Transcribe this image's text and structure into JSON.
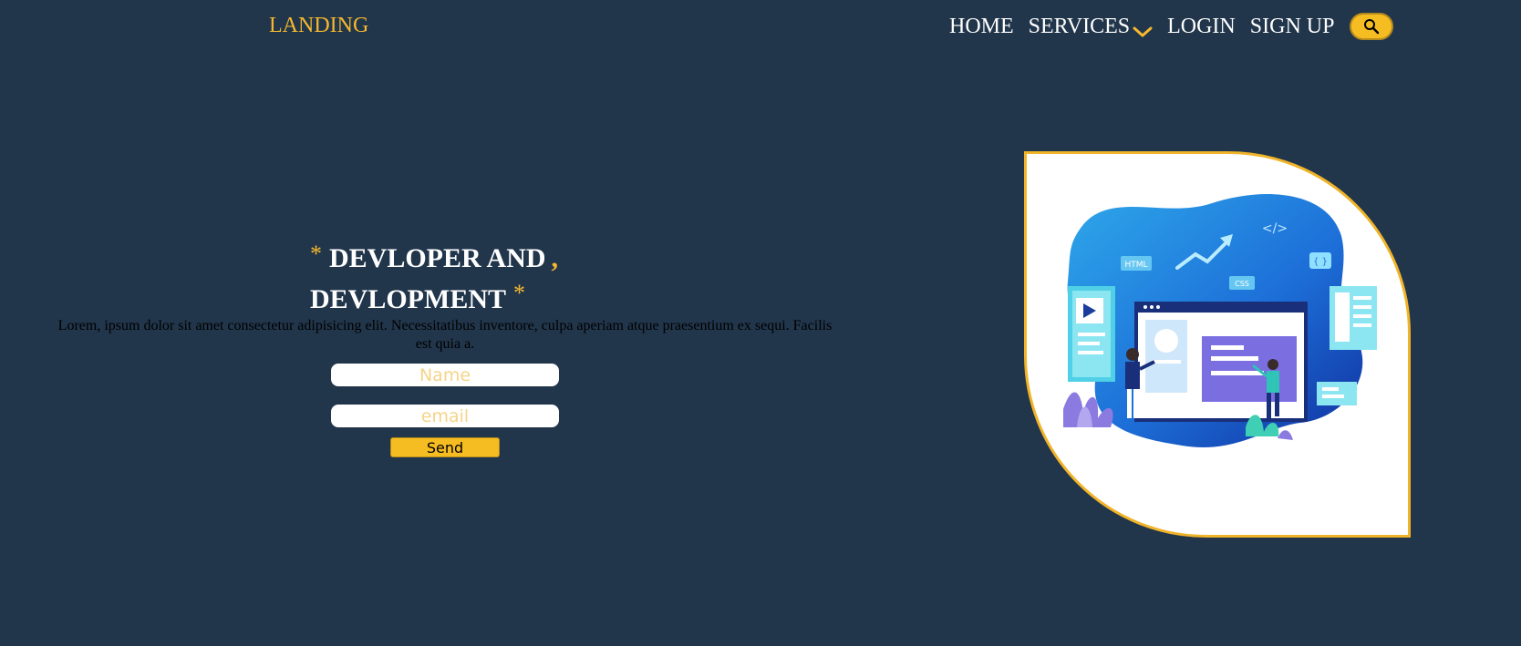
{
  "header": {
    "logo": "LANDING",
    "nav": {
      "home": "HOME",
      "services": "SERVICES",
      "login": "LOGIN",
      "signup": "SIGN UP"
    }
  },
  "hero": {
    "star": "*",
    "line1": "DEVLOPER AND",
    "comma": ",",
    "line2": "DEVLOPMENT",
    "description": "Lorem, ipsum dolor sit amet consectetur adipisicing elit. Necessitatibus inventore, culpa aperiam atque praesentium ex sequi. Facilis est quia a.",
    "form": {
      "name_placeholder": "Name",
      "email_placeholder": "email",
      "send_label": "Send"
    }
  },
  "illustration": {
    "tags": {
      "html": "HTML",
      "css": "CSS",
      "code": "</>",
      "brackets": "{ }"
    }
  },
  "colors": {
    "background": "#21354b",
    "accent": "#f4b82e",
    "button": "#f6bd22"
  },
  "icons": {
    "services_dropdown": "chevron-down-icon",
    "search": "search-icon"
  }
}
